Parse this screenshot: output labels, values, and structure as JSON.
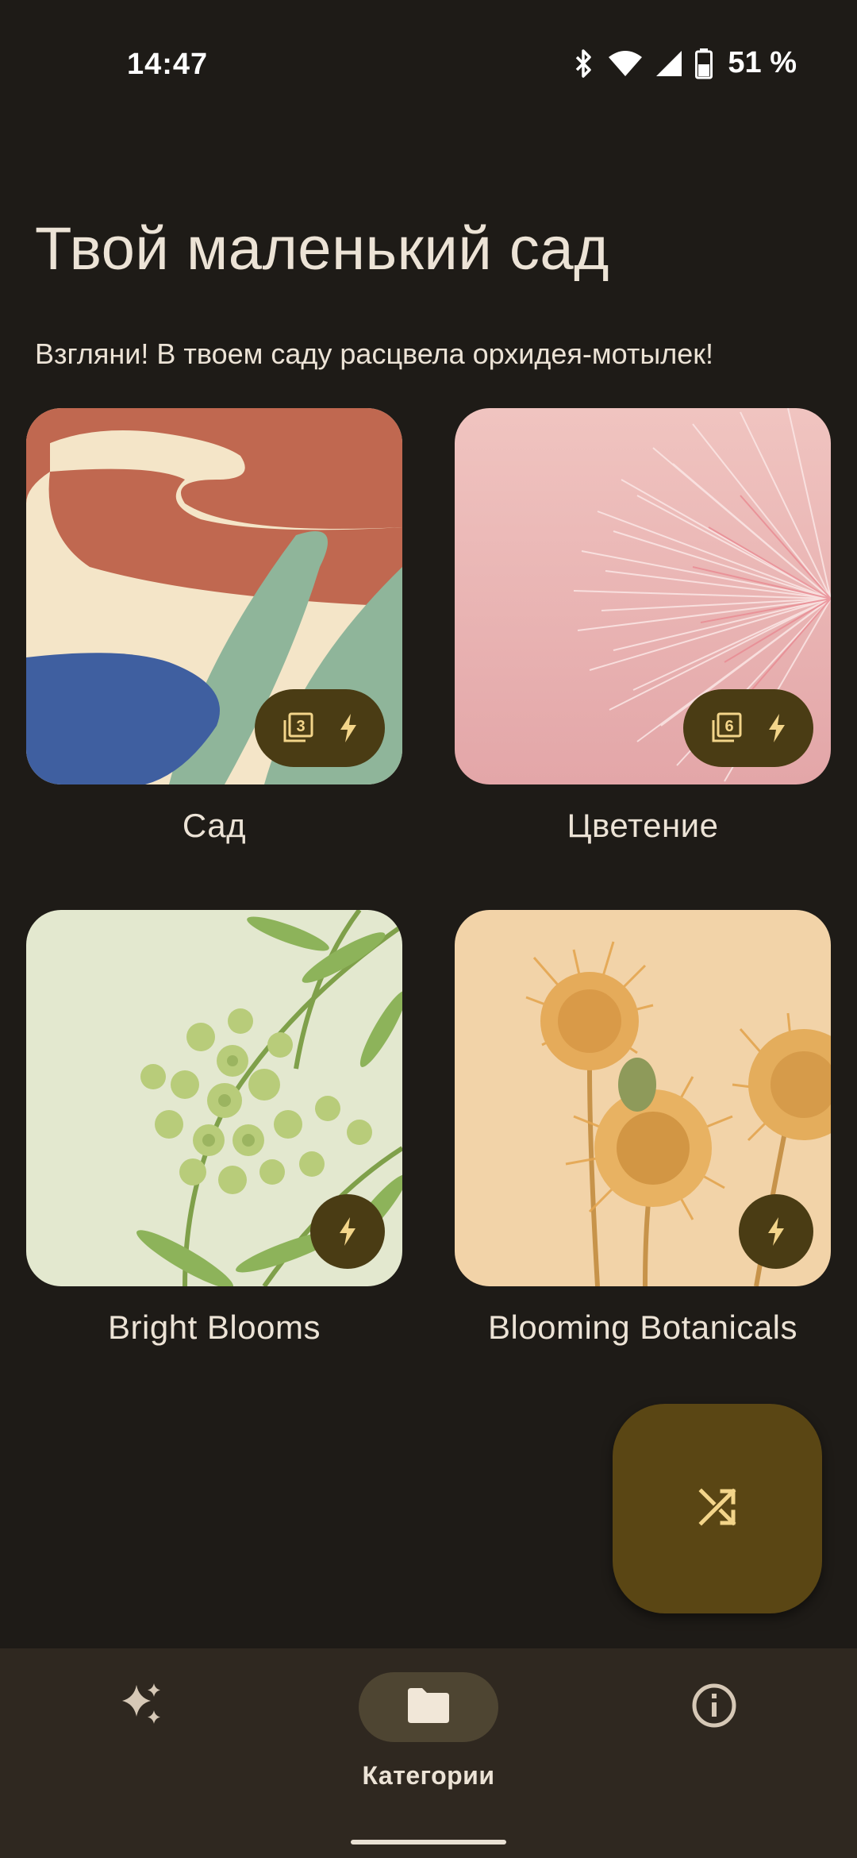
{
  "status_bar": {
    "time": "14:47",
    "battery": "51 %",
    "icons": [
      "bluetooth-icon",
      "wifi-icon",
      "cell-signal-icon",
      "battery-icon"
    ]
  },
  "header": {
    "title": "Твой маленький сад",
    "subtitle": "Взгляни! В твоем саду расцвела орхидея-мотылек!"
  },
  "categories": [
    {
      "label": "Сад",
      "count": "3",
      "badge_icons": [
        "collection-icon",
        "bolt-icon"
      ]
    },
    {
      "label": "Цветение",
      "count": "6",
      "badge_icons": [
        "collection-icon",
        "bolt-icon"
      ]
    },
    {
      "label": "Bright Blooms",
      "badge_icons": [
        "bolt-icon"
      ]
    },
    {
      "label": "Blooming Botanicals",
      "badge_icons": [
        "bolt-icon"
      ]
    }
  ],
  "fab": {
    "icon": "shuffle-icon"
  },
  "bottom_nav": {
    "items": [
      {
        "icon": "sparkle-icon",
        "label": ""
      },
      {
        "icon": "folder-icon",
        "label": "Категории",
        "active": true
      },
      {
        "icon": "info-icon",
        "label": ""
      }
    ]
  },
  "colors": {
    "background": "#1e1b17",
    "text": "#ece3d6",
    "badge": "#4a3c14",
    "accent_icon": "#f3d58a",
    "fab": "#5a4614",
    "nav_bar": "#2f2820",
    "nav_active_pill": "#4e4532"
  }
}
